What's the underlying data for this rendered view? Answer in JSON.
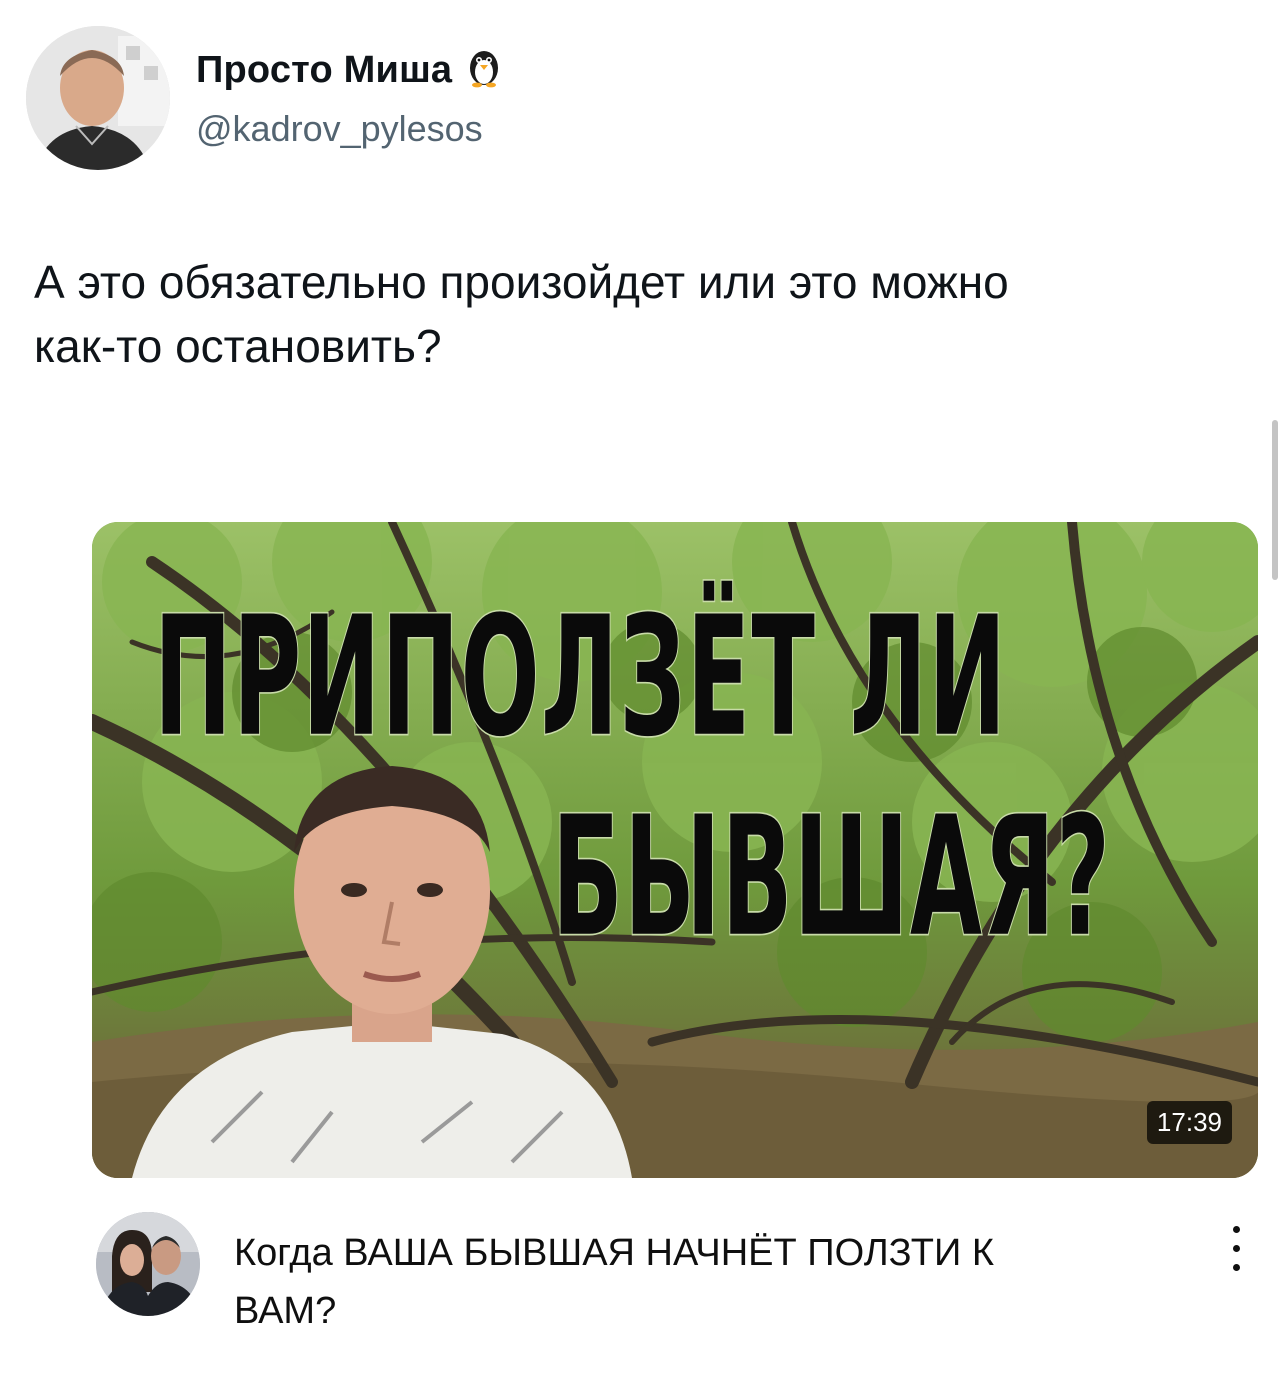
{
  "tweet": {
    "author": {
      "display_name": "Просто Миша",
      "handle": "@kadrov_pylesos",
      "badge_icon": "penguin-icon"
    },
    "text_lines": [
      "А это обязательно произойдет или это можно",
      "как-то остановить?"
    ]
  },
  "embedded_video": {
    "thumbnail": {
      "title_lines": [
        "ПРИПОЛЗЁТ ЛИ",
        "БЫВШАЯ?"
      ]
    },
    "duration": "17:39",
    "title_lines": [
      "Когда ВАША БЫВШАЯ НАЧНЁТ ПОЛЗТИ К",
      "ВАМ?"
    ],
    "menu_icon": "kebab-menu-icon"
  },
  "colors": {
    "text_primary": "#0f1419",
    "text_secondary": "#536471",
    "forest_green": "#6d8f3a"
  }
}
